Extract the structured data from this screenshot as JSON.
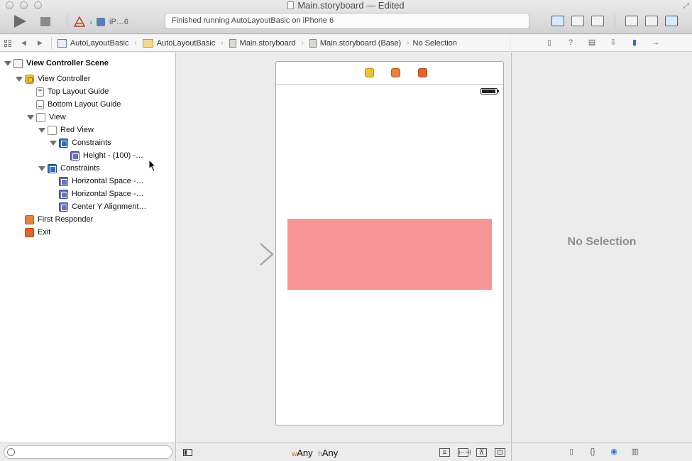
{
  "window": {
    "title": "Main.storyboard — Edited"
  },
  "toolbar": {
    "run_label": "Run",
    "stop_label": "Stop",
    "scheme_device": "iP…6",
    "activity_status": "Finished running AutoLayoutBasic on iPhone 6"
  },
  "jumpbar": {
    "crumbs": [
      "AutoLayoutBasic",
      "AutoLayoutBasic",
      "Main.storyboard",
      "Main.storyboard (Base)",
      "No Selection"
    ]
  },
  "outline": {
    "rows": [
      {
        "label": "View Controller Scene"
      },
      {
        "label": "View Controller"
      },
      {
        "label": "Top Layout Guide"
      },
      {
        "label": "Bottom Layout Guide"
      },
      {
        "label": "View"
      },
      {
        "label": "Red View"
      },
      {
        "label": "Constraints"
      },
      {
        "label": "Height - (100) -…"
      },
      {
        "label": "Constraints"
      },
      {
        "label": "Horizontal Space -…"
      },
      {
        "label": "Horizontal Space -…"
      },
      {
        "label": "Center Y Alignment…"
      },
      {
        "label": "First Responder"
      },
      {
        "label": "Exit"
      }
    ]
  },
  "canvas": {
    "size_class_w_prefix": "w",
    "size_class_w": "Any",
    "size_class_h_prefix": "h",
    "size_class_h": "Any",
    "red_view_color": "#f79696"
  },
  "inspector": {
    "empty_label": "No Selection"
  },
  "colors": {
    "accent": "#2b6fd9",
    "view_controller_icon": "#f1c232",
    "first_responder_icon": "#e6813a",
    "exit_icon": "#e1662c"
  }
}
